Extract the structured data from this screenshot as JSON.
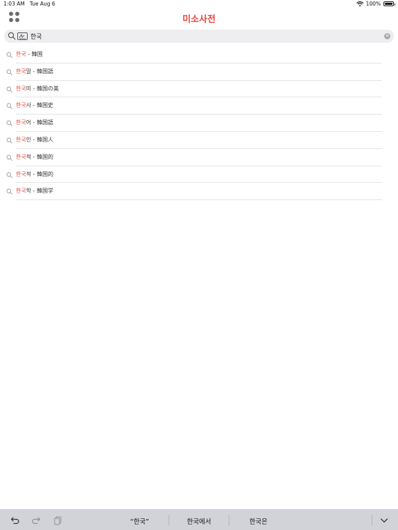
{
  "status_bar": {
    "time": "1:03 AM",
    "date": "Tue Aug 6",
    "battery": "100%",
    "battery_level": 1.0
  },
  "nav": {
    "title": "미소사전",
    "menu_icon": "grid-icon",
    "accent_color": "#e6453a"
  },
  "search": {
    "value": "한국",
    "placeholder": ""
  },
  "results": [
    {
      "highlight": "한국",
      "rest": "",
      "separator": " - ",
      "translation": "韓国"
    },
    {
      "highlight": "한국",
      "rest": "말",
      "separator": " - ",
      "translation": "韓国語"
    },
    {
      "highlight": "한국",
      "rest": "미",
      "separator": " - ",
      "translation": "韓国の美"
    },
    {
      "highlight": "한국",
      "rest": "사",
      "separator": " - ",
      "translation": "韓国史"
    },
    {
      "highlight": "한국",
      "rest": "어",
      "separator": " - ",
      "translation": "韓国語"
    },
    {
      "highlight": "한국",
      "rest": "인",
      "separator": " - ",
      "translation": "韓国人"
    },
    {
      "highlight": "한국",
      "rest": "적",
      "separator": " - ",
      "translation": "韓国的"
    },
    {
      "highlight": "한국",
      "rest": "적",
      "separator": " - ",
      "translation": "韓国的"
    },
    {
      "highlight": "한국",
      "rest": "학",
      "separator": " - ",
      "translation": "韓国学"
    }
  ],
  "keyboard_bar": {
    "suggestions": [
      "“한국”",
      "한국에서",
      "한국은"
    ]
  }
}
